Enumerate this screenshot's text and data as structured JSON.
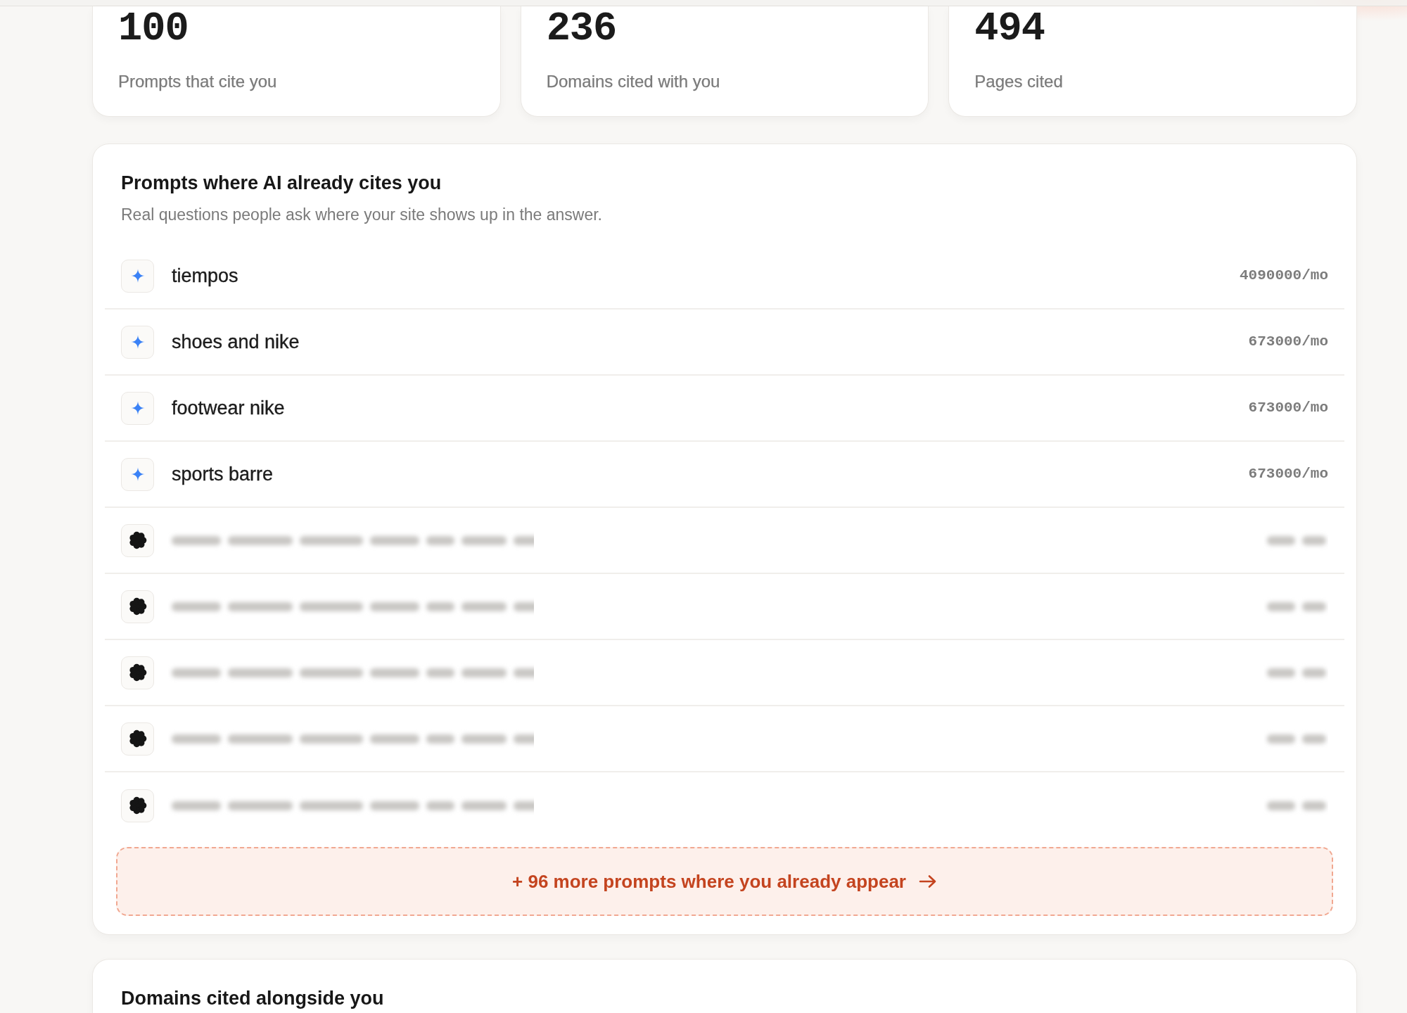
{
  "stats": [
    {
      "value": "100",
      "label": "Prompts that cite you"
    },
    {
      "value": "236",
      "label": "Domains cited with you"
    },
    {
      "value": "494",
      "label": "Pages cited"
    }
  ],
  "cited_prompts": {
    "title": "Prompts where AI already cites you",
    "subtitle": "Real questions people ask where your site shows up in the answer.",
    "rows": [
      {
        "kind": "visible",
        "prompt": "tiempos",
        "volume": "4090000/mo"
      },
      {
        "kind": "visible",
        "prompt": "shoes and nike",
        "volume": "673000/mo"
      },
      {
        "kind": "visible",
        "prompt": "footwear nike",
        "volume": "673000/mo"
      },
      {
        "kind": "visible",
        "prompt": "sports barre",
        "volume": "673000/mo"
      },
      {
        "kind": "blurred"
      },
      {
        "kind": "blurred"
      },
      {
        "kind": "blurred"
      },
      {
        "kind": "blurred"
      },
      {
        "kind": "blurred"
      }
    ],
    "more_link": "+ 96 more prompts where you already appear"
  },
  "domains_panel": {
    "title": "Domains cited alongside you"
  }
}
